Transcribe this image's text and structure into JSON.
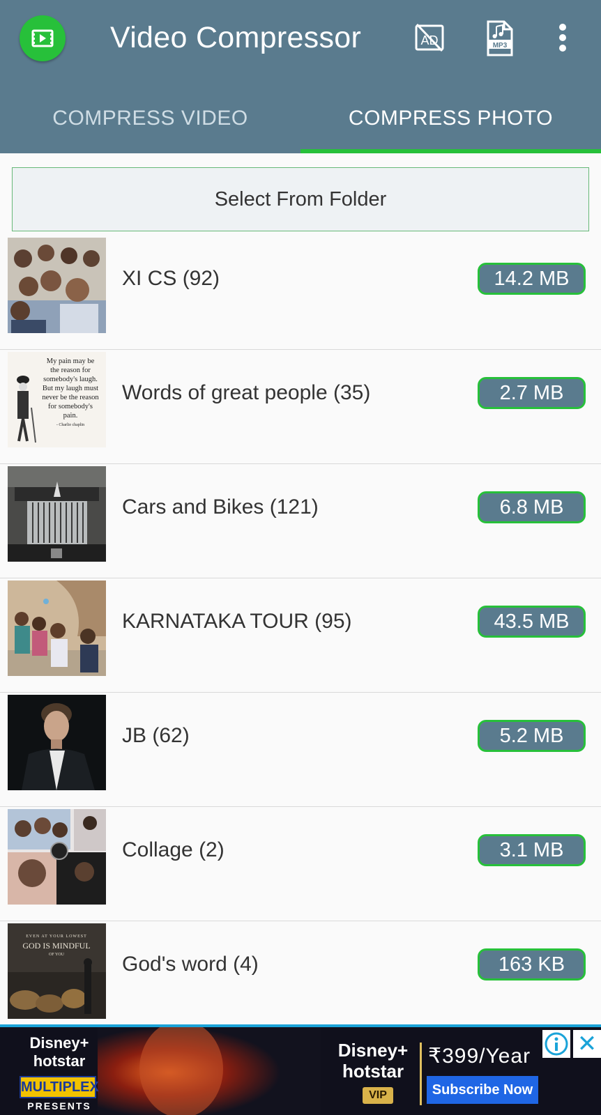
{
  "app": {
    "title": "Video Compressor",
    "logo_icon": "film-frame-icon",
    "accent_color": "#27c03a",
    "toolbar_color": "#5a7b8e",
    "ad_off_icon_text": "AD",
    "mp3_icon_text": "MP3"
  },
  "tabs": [
    {
      "label": "COMPRESS VIDEO",
      "selected": false
    },
    {
      "label": "COMPRESS PHOTO",
      "selected": true
    }
  ],
  "select_folder_label": "Select From Folder",
  "folders": [
    {
      "name": "XI CS (92)",
      "size": "14.2 MB",
      "thumb": "group-selfie-photo"
    },
    {
      "name": "Words of great people (35)",
      "size": "2.7 MB",
      "thumb": "charlie-chaplin-quote",
      "thumb_text": [
        "My pain may be",
        "the reason for",
        "somebody's laugh.",
        "But my laugh must",
        "never be the reason",
        "for somebody's",
        "pain.",
        "- Charlie chaplin"
      ]
    },
    {
      "name": "Cars and Bikes (121)",
      "size": "6.8 MB",
      "thumb": "rolls-royce-grille-photo"
    },
    {
      "name": "KARNATAKA TOUR (95)",
      "size": "43.5 MB",
      "thumb": "group-tour-photo"
    },
    {
      "name": "JB (62)",
      "size": "5.2 MB",
      "thumb": "portrait-photo"
    },
    {
      "name": "Collage (2)",
      "size": "3.1 MB",
      "thumb": "photo-collage"
    },
    {
      "name": "God's word (4)",
      "size": "163 KB",
      "thumb": "lions-den-poster",
      "thumb_text": [
        "EVEN AT YOUR LOWEST",
        "GOD IS MINDFUL",
        "OF YOU"
      ]
    }
  ],
  "ad": {
    "left_brand": [
      "Disney+",
      "hotstar"
    ],
    "multiplex": "MULTIPLEX",
    "presents": "PRESENTS",
    "right_brand": [
      "Disney+",
      "hotstar"
    ],
    "vip": "VIP",
    "price": "₹399/Year",
    "cta": "Subscribe Now",
    "close_glyph": "✕"
  }
}
